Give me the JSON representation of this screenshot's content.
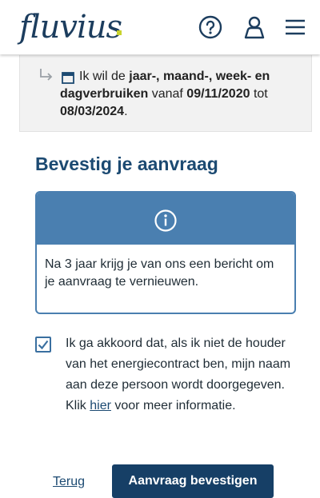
{
  "header": {
    "logo_text": "fluvius",
    "icons": [
      "help-icon",
      "user-icon",
      "menu-icon"
    ],
    "brand_color": "#1c3d5e",
    "accent_color": "#c9d32d"
  },
  "summary": {
    "prefix": "Ik wil de ",
    "bold_type": "jaar-, maand-, week- en dagverbruiken",
    "mid": " vanaf ",
    "date_from": "09/11/2020",
    "tot": " tot ",
    "date_to": "08/03/2024",
    "suffix": "."
  },
  "page_title": "Bevestig je aanvraag",
  "info": {
    "text": "Na 3 jaar krijg je van ons een bericht om je aanvraag te vernieuwen.",
    "color": "#4a7fb0"
  },
  "consent": {
    "checked": true,
    "text": "Ik ga akkoord dat, als ik niet de houder van het energiecontract ben, mijn naam aan deze persoon wordt doorgegeven.",
    "more_prefix": "Klik ",
    "more_link": "hier",
    "more_suffix": " voor meer informatie."
  },
  "actions": {
    "back_label": "Terug",
    "confirm_label": "Aanvraag bevestigen",
    "confirm_color": "#163f66"
  }
}
